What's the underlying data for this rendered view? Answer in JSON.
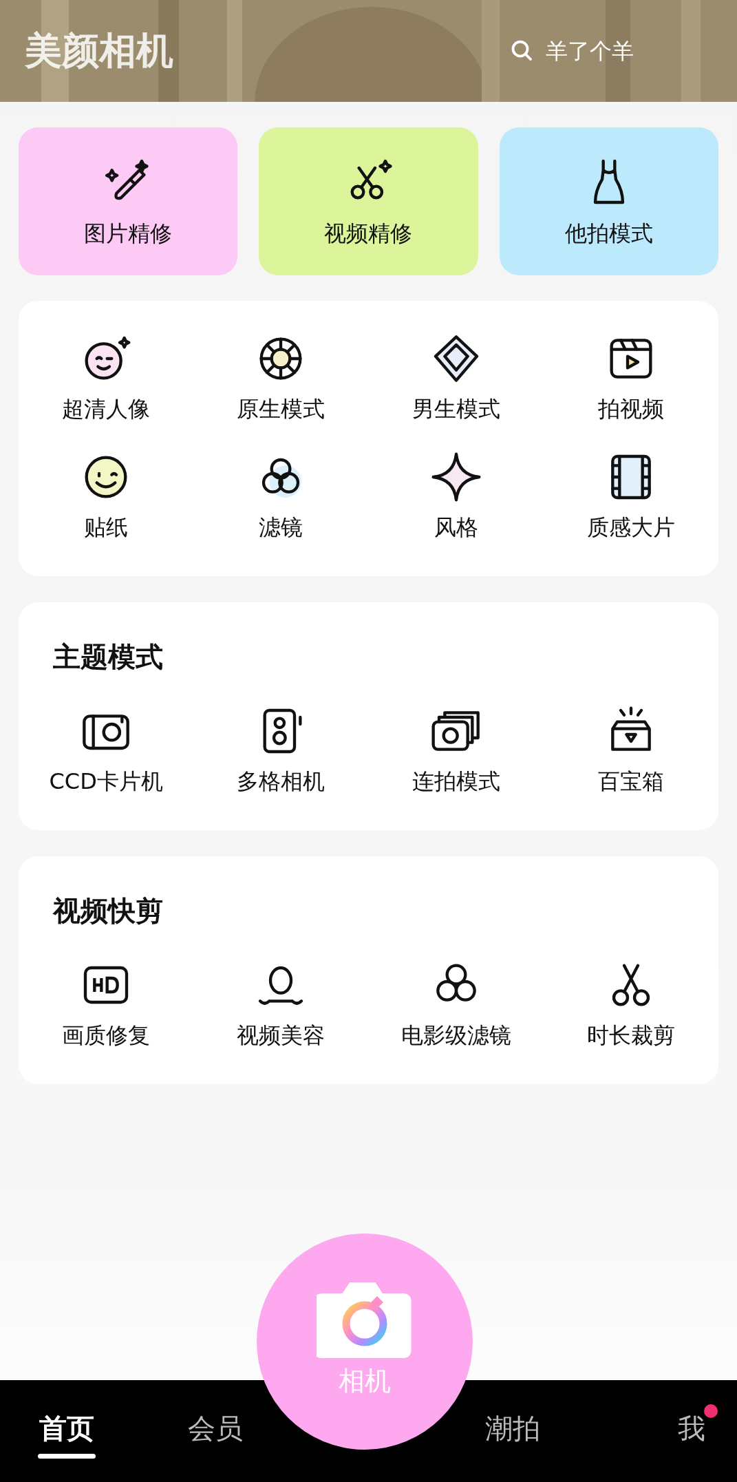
{
  "header": {
    "title": "美颜相机",
    "search": {
      "placeholder": "羊了个羊"
    }
  },
  "quick_actions": [
    {
      "label": "图片精修",
      "color": "#fdc9f5"
    },
    {
      "label": "视频精修",
      "color": "#ddf59a"
    },
    {
      "label": "他拍模式",
      "color": "#bde9fd"
    }
  ],
  "tools": [
    "超清人像",
    "原生模式",
    "男生模式",
    "拍视频",
    "贴纸",
    "滤镜",
    "风格",
    "质感大片"
  ],
  "sections": [
    {
      "title": "主题模式",
      "items": [
        "CCD卡片机",
        "多格相机",
        "连拍模式",
        "百宝箱"
      ]
    },
    {
      "title": "视频快剪",
      "items": [
        "画质修复",
        "视频美容",
        "电影级滤镜",
        "时长裁剪"
      ]
    }
  ],
  "camera_button": {
    "label": "相机"
  },
  "tabs": [
    {
      "label": "首页",
      "selected": true,
      "badge": false
    },
    {
      "label": "会员",
      "selected": false,
      "badge": false
    },
    {
      "label": "潮拍",
      "selected": false,
      "badge": false
    },
    {
      "label": "我",
      "selected": false,
      "badge": true
    }
  ]
}
